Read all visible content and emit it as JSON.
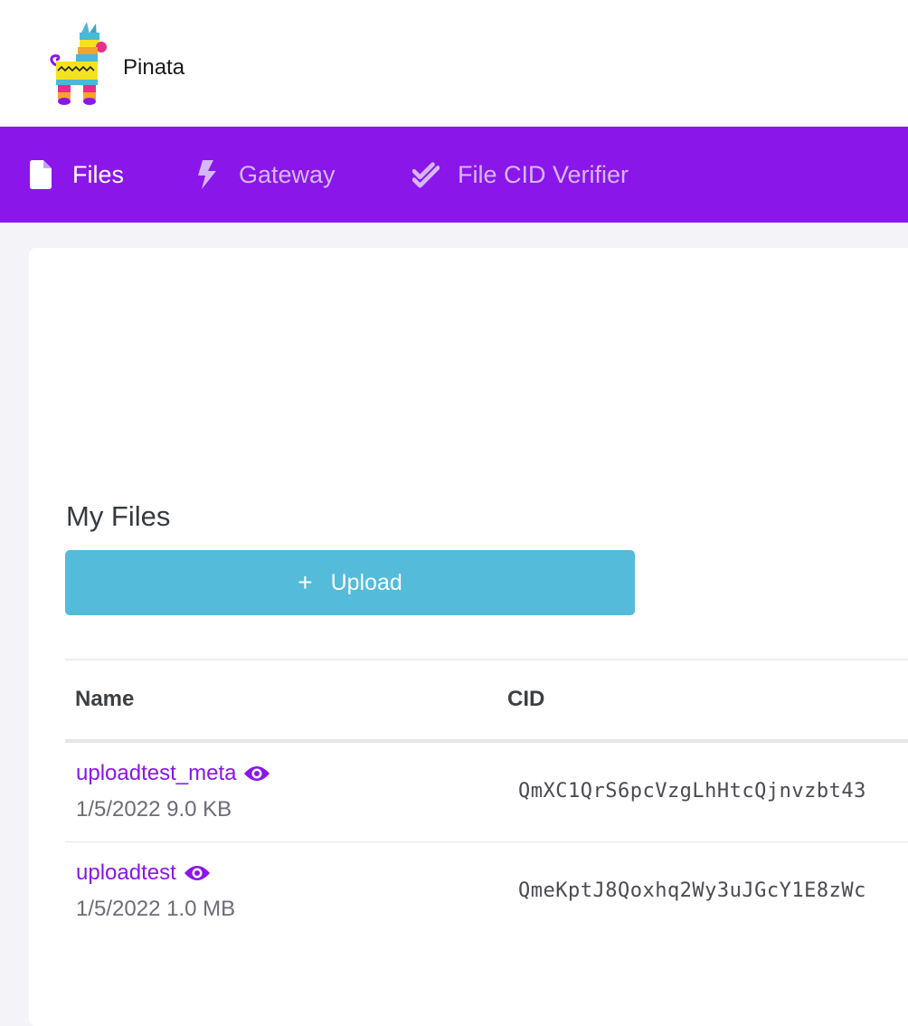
{
  "header": {
    "brand": "Pinata",
    "logo_icon": "pinata-llama-logo"
  },
  "nav": {
    "background": "#8a16e9",
    "items": [
      {
        "label": "Files",
        "icon": "file-icon",
        "active": true
      },
      {
        "label": "Gateway",
        "icon": "lightning-icon",
        "active": false
      },
      {
        "label": "File CID Verifier",
        "icon": "double-check-icon",
        "active": false
      }
    ]
  },
  "main": {
    "title": "My Files",
    "upload": {
      "icon": "plus-icon",
      "label": "Upload",
      "color": "#54bbda"
    },
    "table": {
      "columns": [
        "Name",
        "CID"
      ],
      "rows": [
        {
          "name": "uploadtest_meta",
          "meta": "1/5/2022 9.0 KB",
          "cid": "QmXC1QrS6pcVzgLhHtcQjnvzbt43"
        },
        {
          "name": "uploadtest",
          "meta": "1/5/2022 1.0 MB",
          "cid": "QmeKptJ8Qoxhq2Wy3uJGcY1E8zWc"
        }
      ]
    }
  }
}
